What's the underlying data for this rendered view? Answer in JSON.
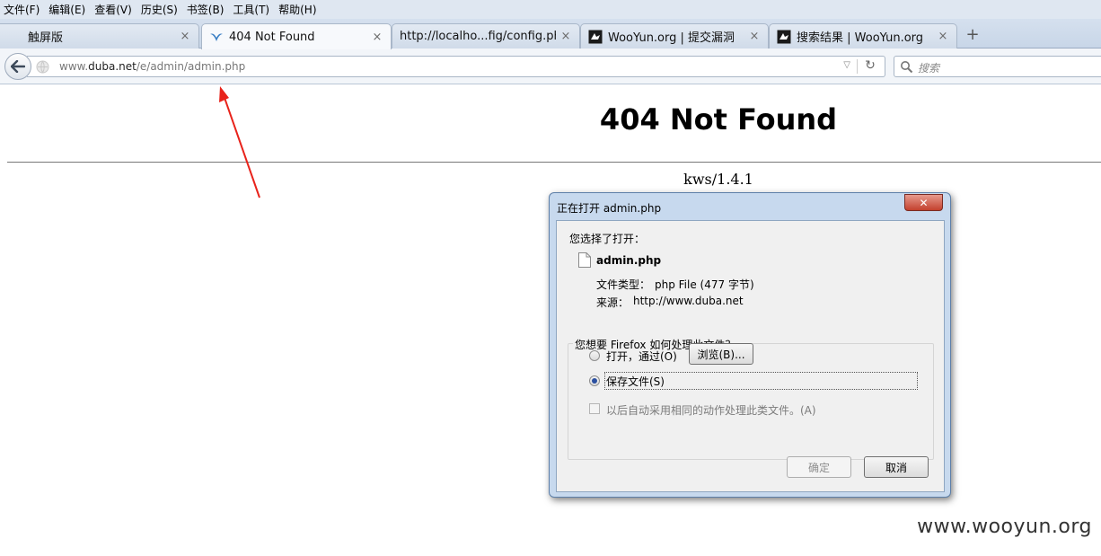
{
  "menu": [
    "文件(F)",
    "编辑(E)",
    "查看(V)",
    "历史(S)",
    "书签(B)",
    "工具(T)",
    "帮助(H)"
  ],
  "tabs": [
    {
      "label": "触屏版",
      "icon": "none"
    },
    {
      "label": "404 Not Found",
      "icon": "bird-favicon-icon",
      "active": true
    },
    {
      "label": "http://localho...fig/config.php",
      "icon": "none"
    },
    {
      "label": "WooYun.org | 提交漏洞",
      "icon": "wooyun-favicon-icon"
    },
    {
      "label": "搜索结果 | WooYun.org",
      "icon": "wooyun-favicon-icon"
    }
  ],
  "tab_close_glyph": "×",
  "new_tab_glyph": "+",
  "nav": {
    "url_host": "www.",
    "url_domain": "duba.net",
    "url_path": "/e/admin/admin.php",
    "search_placeholder": "搜索"
  },
  "page": {
    "title": "404 Not Found",
    "server": "kws/1.4.1"
  },
  "dialog": {
    "title": "正在打开 admin.php",
    "close_glyph": "✕",
    "chosen_label": "您选择了打开：",
    "filename": "admin.php",
    "type_label": "文件类型：",
    "type_value": "php File (477 字节)",
    "source_label": "来源：",
    "source_value": "http://www.duba.net",
    "question": "您想要 Firefox 如何处理此文件？",
    "open_with_label": "打开，通过(O)",
    "browse_button": "浏览(B)...",
    "save_label": "保存文件(S)",
    "auto_label": "以后自动采用相同的动作处理此类文件。(A)",
    "ok_button": "确定",
    "cancel_button": "取消",
    "selected_option": "save"
  },
  "watermark": "www.wooyun.org",
  "colors": {
    "arrow": "#e8231b",
    "close_button": "#c3412e"
  }
}
